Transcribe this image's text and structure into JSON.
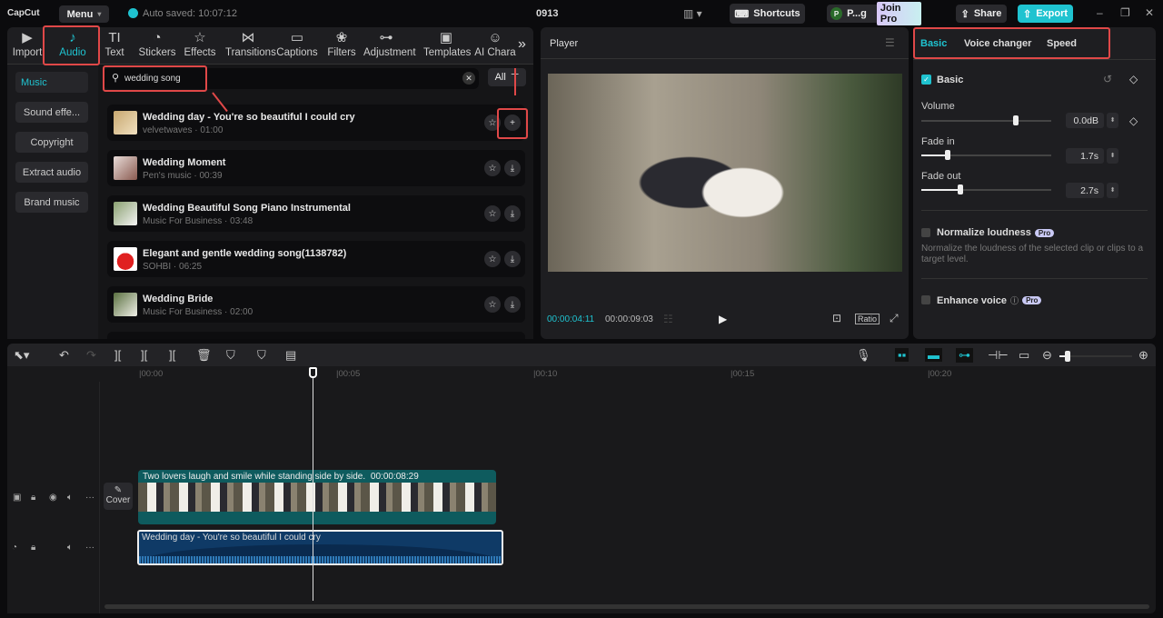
{
  "app": {
    "logo": "CapCut",
    "menu": "Menu",
    "autosave": "Auto saved: 10:07:12",
    "project": "0913",
    "shortcuts": "Shortcuts",
    "user_initial": "P",
    "user_name": "P...g",
    "join_pro": "Join Pro",
    "share": "Share",
    "export": "Export"
  },
  "tabs": [
    {
      "label": "Import",
      "icon": "import-icon"
    },
    {
      "label": "Audio",
      "icon": "music-note-icon"
    },
    {
      "label": "Text",
      "icon": "text-icon"
    },
    {
      "label": "Stickers",
      "icon": "sticker-icon"
    },
    {
      "label": "Effects",
      "icon": "effects-icon"
    },
    {
      "label": "Transitions",
      "icon": "transition-icon"
    },
    {
      "label": "Captions",
      "icon": "captions-icon"
    },
    {
      "label": "Filters",
      "icon": "filters-icon"
    },
    {
      "label": "Adjustment",
      "icon": "adjust-icon"
    },
    {
      "label": "Templates",
      "icon": "templates-icon"
    },
    {
      "label": "AI Chara",
      "icon": "ai-character-icon"
    }
  ],
  "sidebar": [
    "Music",
    "Sound effe...",
    "Copyright",
    "Extract audio",
    "Brand music"
  ],
  "search": {
    "value": "wedding song",
    "filter": "All"
  },
  "songs": [
    {
      "title": "Wedding day - You're so beautiful I could cry",
      "meta": "velvetwaves · 01:00"
    },
    {
      "title": "Wedding Moment",
      "meta": "Pen's music · 00:39"
    },
    {
      "title": "Wedding Beautiful Song Piano Instrumental",
      "meta": "Music For Business · 03:48"
    },
    {
      "title": "Elegant and gentle wedding song(1138782)",
      "meta": "SOHBI · 06:25"
    },
    {
      "title": "Wedding Bride",
      "meta": "Music For Business · 02:00"
    }
  ],
  "player": {
    "title": "Player",
    "current": "00:00:04:11",
    "total": "00:00:09:03",
    "ratio": "Ratio"
  },
  "props": {
    "tabs": [
      "Basic",
      "Voice changer",
      "Speed"
    ],
    "section": "Basic",
    "volume_label": "Volume",
    "volume": "0.0dB",
    "volume_level": 0.73,
    "fadein_label": "Fade in",
    "fadein": "1.7s",
    "fadein_level": 0.2,
    "fadeout_label": "Fade out",
    "fadeout": "2.7s",
    "fadeout_level": 0.3,
    "normalize": "Normalize loudness",
    "normalize_desc": "Normalize the loudness of the selected clip or clips to a target level.",
    "enhance": "Enhance voice",
    "pro": "Pro"
  },
  "timeline": {
    "ticks": [
      "00:00",
      "00:05",
      "00:10",
      "00:15",
      "00:20"
    ],
    "cover": "Cover",
    "video_clip": "Two lovers laugh and smile while standing side by side.",
    "video_duration": "00:00:08:29",
    "audio_clip": "Wedding day - You're so beautiful I could cry",
    "playhead_seconds": 4.4
  },
  "colors": {
    "accent": "#1fc3d0",
    "annotation": "#e04848"
  }
}
